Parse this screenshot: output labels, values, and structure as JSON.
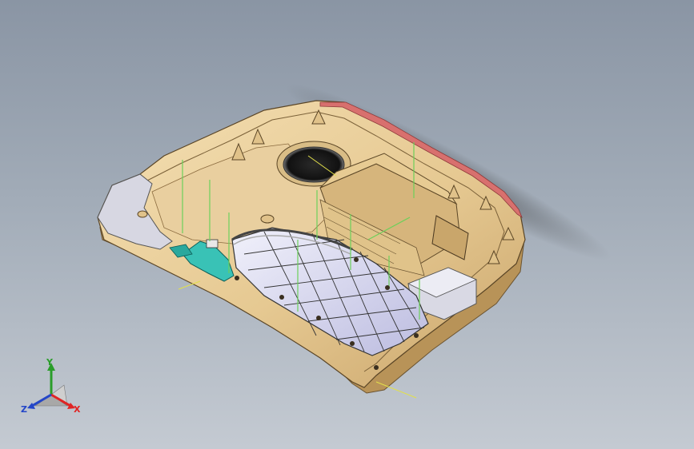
{
  "scene": {
    "background_top": "#8a95a4",
    "background_bottom": "#c4cad2",
    "part_color": "#e8cf9c",
    "part_dark": "#c9a66b",
    "red_edge": "#d8706e",
    "panel_color": "#dcdcf2",
    "pcb_color": "#39c2b6",
    "guide_line_color": "#6cd05a"
  },
  "triad": {
    "x_label": "X",
    "y_label": "Y",
    "z_label": "Z",
    "x_color": "#e02424",
    "y_color": "#2a9d2a",
    "z_color": "#2446c8"
  }
}
